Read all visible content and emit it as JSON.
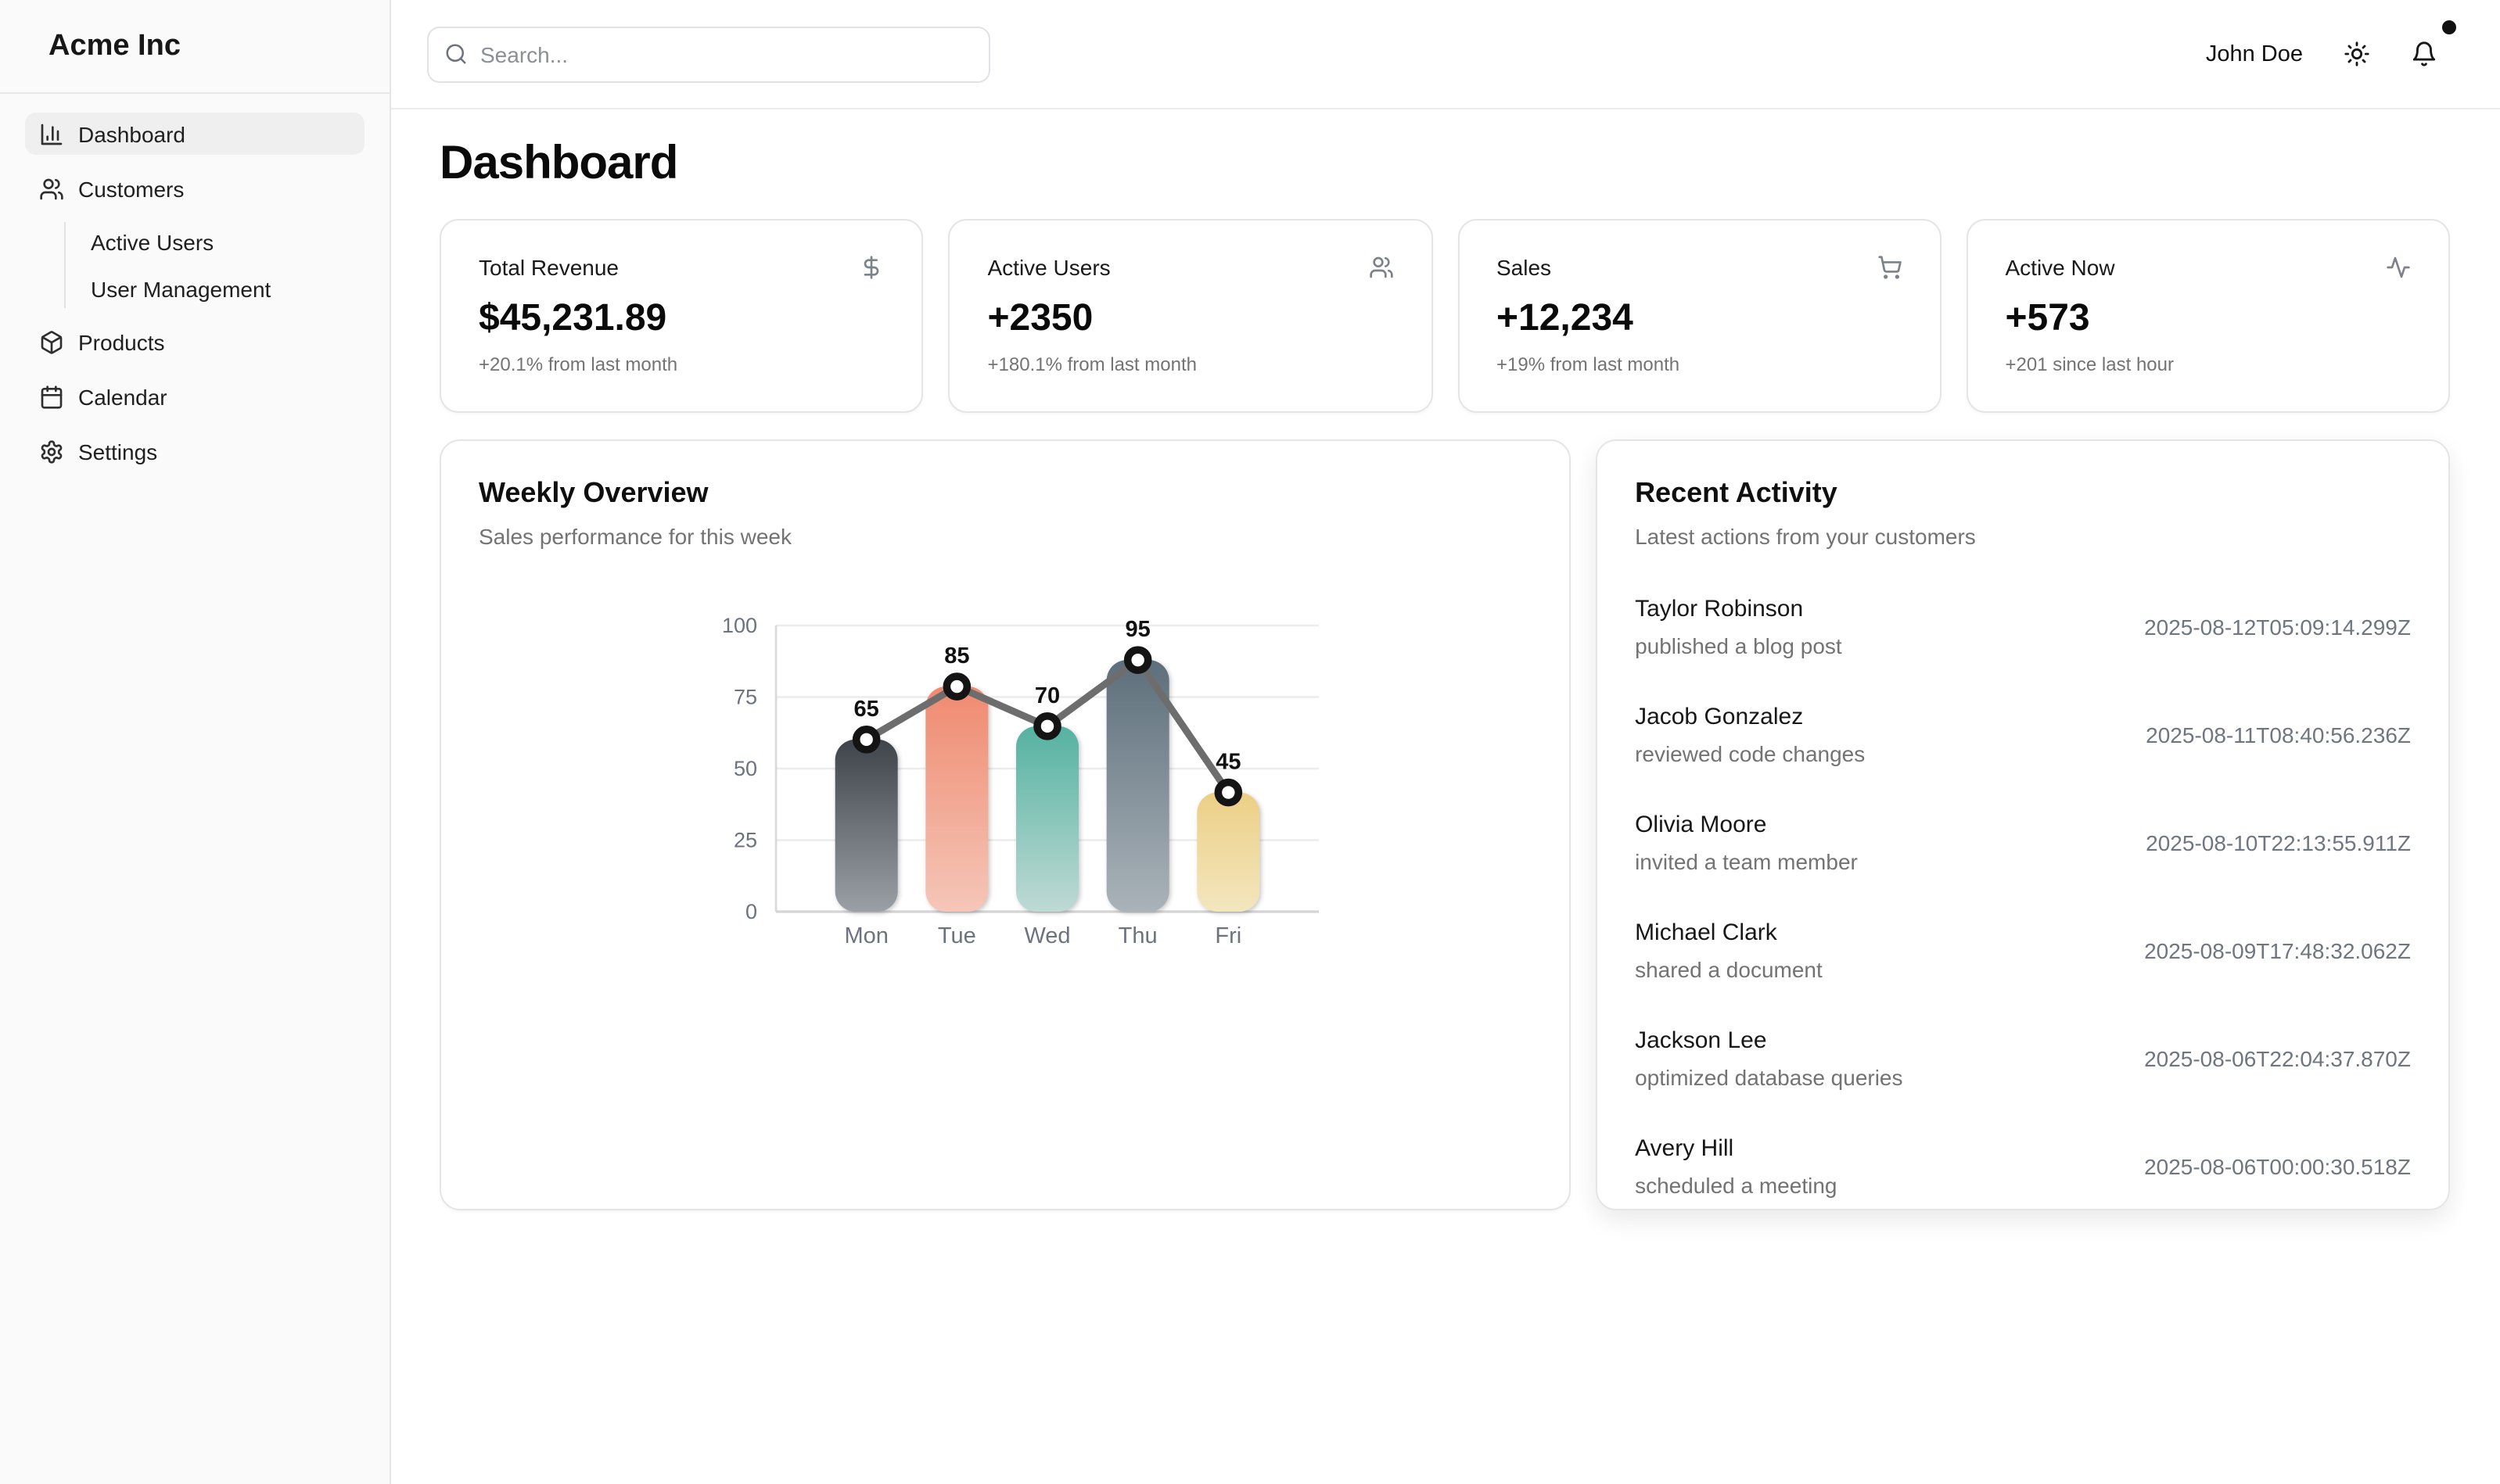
{
  "brand": "Acme Inc",
  "topbar": {
    "search_placeholder": "Search...",
    "user_name": "John Doe"
  },
  "sidebar": {
    "items": [
      {
        "label": "Dashboard",
        "icon": "bar-chart-icon",
        "active": true
      },
      {
        "label": "Customers",
        "icon": "users-icon"
      },
      {
        "label": "Active Users",
        "sub": true
      },
      {
        "label": "User Management",
        "sub": true
      },
      {
        "label": "Products",
        "icon": "package-icon"
      },
      {
        "label": "Calendar",
        "icon": "calendar-icon"
      },
      {
        "label": "Settings",
        "icon": "gear-icon"
      }
    ]
  },
  "page_title": "Dashboard",
  "stats": [
    {
      "label": "Total Revenue",
      "icon": "dollar-icon",
      "value": "$45,231.89",
      "change": "+20.1% from last month"
    },
    {
      "label": "Active Users",
      "icon": "users-icon",
      "value": "+2350",
      "change": "+180.1% from last month"
    },
    {
      "label": "Sales",
      "icon": "cart-icon",
      "value": "+12,234",
      "change": "+19% from last month"
    },
    {
      "label": "Active Now",
      "icon": "activity-icon",
      "value": "+573",
      "change": "+201 since last hour"
    }
  ],
  "weekly": {
    "title": "Weekly Overview",
    "subtitle": "Sales performance for this week"
  },
  "chart_data": {
    "type": "bar",
    "title": "Weekly Overview",
    "categories": [
      "Mon",
      "Tue",
      "Wed",
      "Thu",
      "Fri"
    ],
    "values": [
      65,
      85,
      70,
      95,
      45
    ],
    "series": [
      {
        "name": "sales",
        "values": [
          65,
          85,
          70,
          95,
          45
        ]
      }
    ],
    "xlabel": "",
    "ylabel": "",
    "ylim": [
      0,
      100
    ],
    "yticks": [
      0,
      25,
      50,
      75,
      100
    ],
    "grid": true,
    "legend": false,
    "overlay_line": true,
    "data_labels": true,
    "bar_gradients": [
      {
        "top": "#3f444b",
        "bottom": "#9aa0a6"
      },
      {
        "top": "#ef8a70",
        "bottom": "#f5c6b8"
      },
      {
        "top": "#55b2a1",
        "bottom": "#bedad4"
      },
      {
        "top": "#5d6f7b",
        "bottom": "#aab3b9"
      },
      {
        "top": "#eccf86",
        "bottom": "#f3e6be"
      }
    ],
    "line_color": "#6d6d6d",
    "marker": {
      "fill": "#ffffff",
      "stroke": "#141414"
    },
    "axis_color": "#d9d9d9",
    "grid_color": "#ececec",
    "tick_color": "#6b7280",
    "label_color": "#111111"
  },
  "activity": {
    "title": "Recent Activity",
    "subtitle": "Latest actions from your customers",
    "items": [
      {
        "name": "Taylor Robinson",
        "action": "published a blog post",
        "time": "2025-08-12T05:09:14.299Z"
      },
      {
        "name": "Jacob Gonzalez",
        "action": "reviewed code changes",
        "time": "2025-08-11T08:40:56.236Z"
      },
      {
        "name": "Olivia Moore",
        "action": "invited a team member",
        "time": "2025-08-10T22:13:55.911Z"
      },
      {
        "name": "Michael Clark",
        "action": "shared a document",
        "time": "2025-08-09T17:48:32.062Z"
      },
      {
        "name": "Jackson Lee",
        "action": "optimized database queries",
        "time": "2025-08-06T22:04:37.870Z"
      },
      {
        "name": "Avery Hill",
        "action": "scheduled a meeting",
        "time": "2025-08-06T00:00:30.518Z"
      }
    ]
  }
}
